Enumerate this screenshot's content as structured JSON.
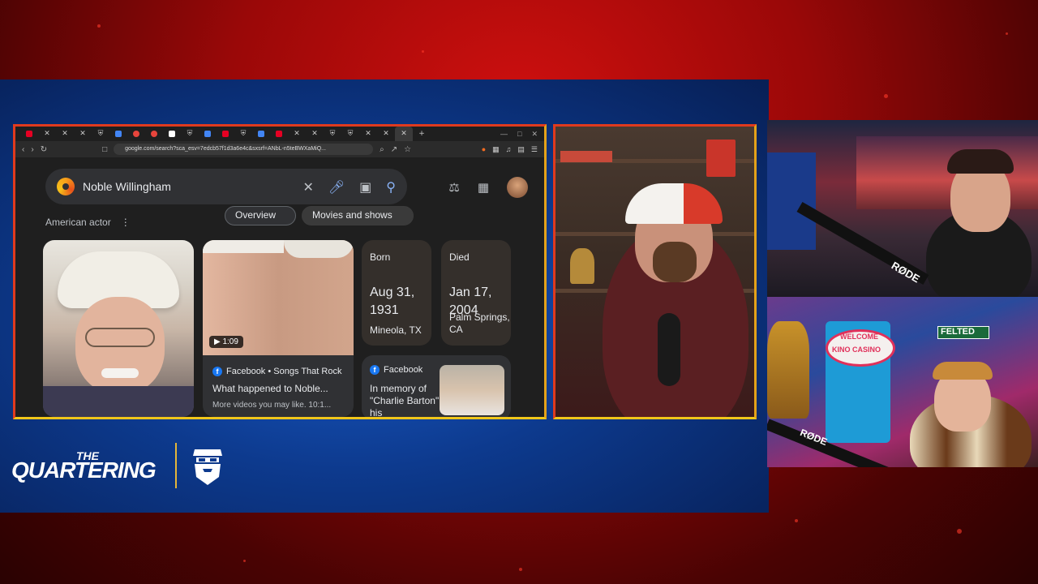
{
  "browser": {
    "url": "google.com/search?sca_esv=7edcb57f1d3a6e4c&sxsrf=ANbL-n5teBWXaMiQ...",
    "tab_icons": [
      "pinterest-icon",
      "x-icon",
      "x-icon",
      "x-icon",
      "shield-icon",
      "grid-icon",
      "stop-icon",
      "stop-icon",
      "news-icon",
      "shield-icon",
      "grid-icon",
      "pinterest-icon",
      "shield-icon",
      "grid-icon",
      "pinterest-icon",
      "x-icon",
      "x-icon",
      "shield-icon",
      "shield-icon",
      "x-icon",
      "x-icon",
      "close-icon",
      "plus-icon"
    ]
  },
  "search": {
    "query": "Noble Willingham"
  },
  "knowledge_panel": {
    "subtitle": "American actor",
    "chips": [
      "Overview",
      "Movies and shows"
    ],
    "video": {
      "duration": "1:09",
      "source": "Facebook • Songs That Rock",
      "title": "What happened to Noble...",
      "subtitle": "More videos you may like. 10:1..."
    },
    "born": {
      "label": "Born",
      "date": "Aug 31, 1931",
      "place": "Mineola, TX"
    },
    "died": {
      "label": "Died",
      "date": "Jan 17, 2004",
      "place": "Palm Springs, CA"
    },
    "post": {
      "source": "Facebook",
      "text": "In memory of \"Charlie Barton\" his"
    }
  },
  "cams": {
    "top_mic_brand": "RØDE",
    "bottom_mic_brand": "RØDE",
    "bottom_sign_welcome": "WELCOME",
    "bottom_sign_casino": "KINO CASINO",
    "bottom_street_sign": "FELTED"
  },
  "branding": {
    "the": "THE",
    "name": "QUARTERING"
  },
  "colors": {
    "frame_red": "#e03a1e",
    "frame_yellow": "#f0c61a",
    "stage_blue": "#1a5bc7",
    "background_red": "#d0100f"
  }
}
